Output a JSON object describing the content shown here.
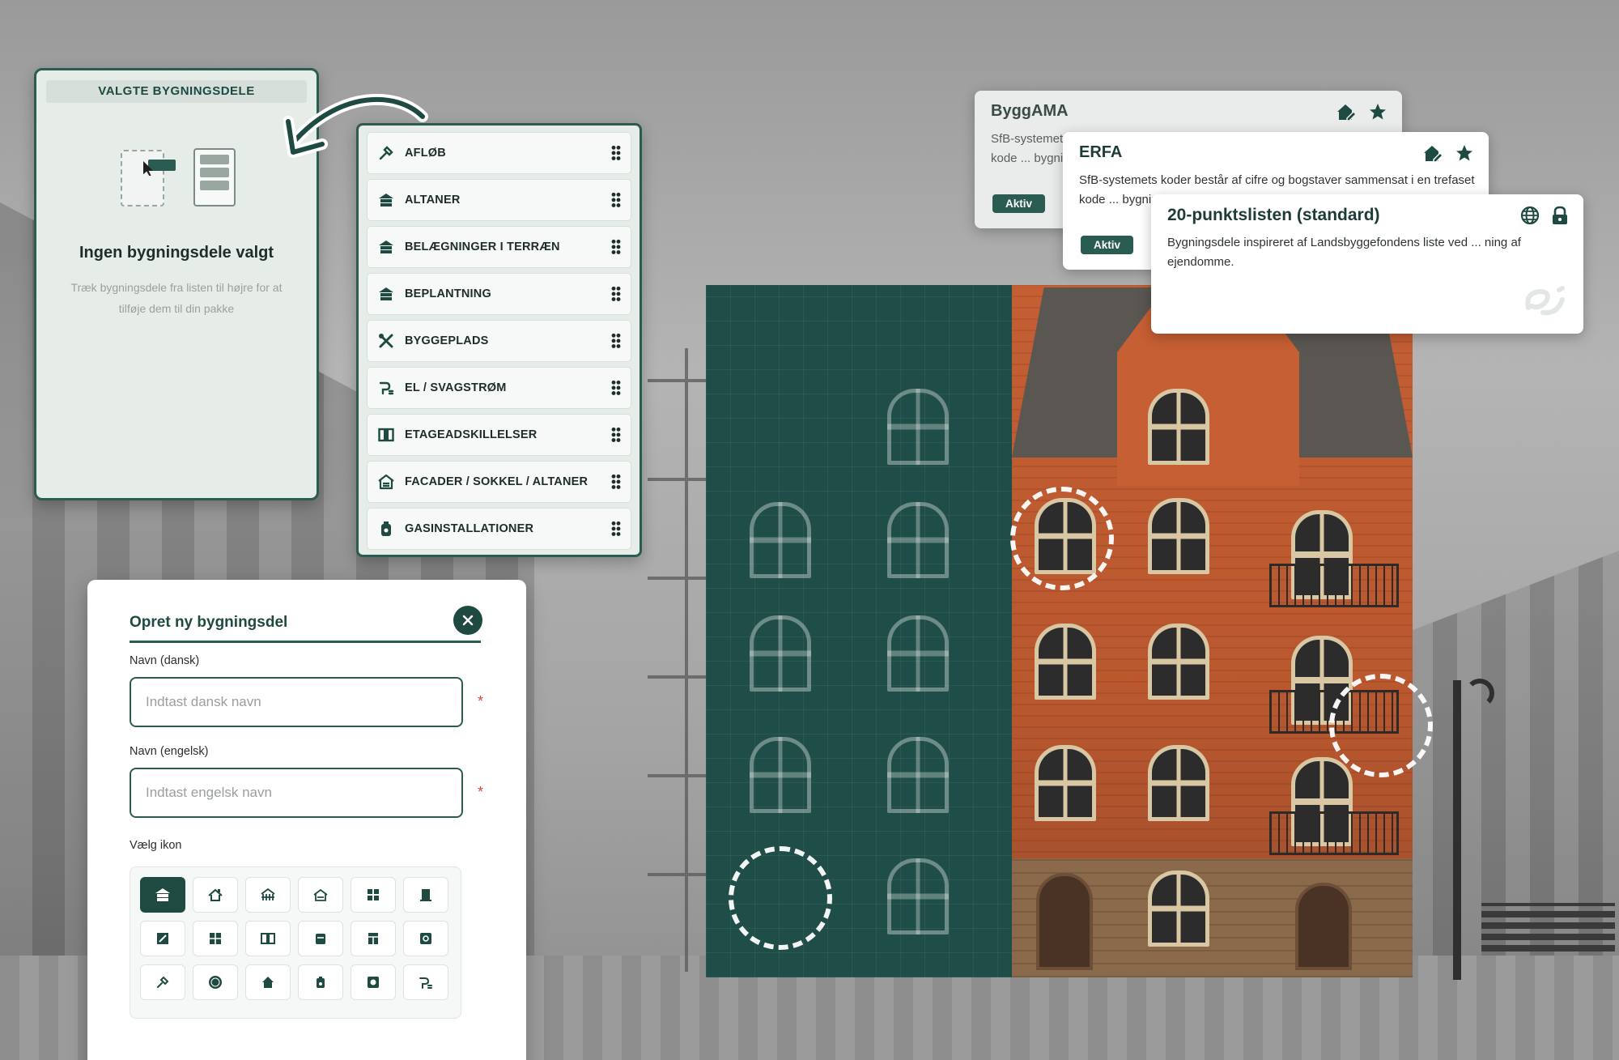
{
  "selected_panel": {
    "header": "VALGTE BYGNINGSDELE",
    "empty_title": "Ingen bygningsdele valgt",
    "empty_text": "Træk bygningsdele fra listen til højre for at tilføje dem til din pakke"
  },
  "building_parts": [
    {
      "label": "AFLØB",
      "icon": "drill-icon"
    },
    {
      "label": "ALTANER",
      "icon": "building-icon"
    },
    {
      "label": "BELÆGNINGER I TERRÆN",
      "icon": "building-icon"
    },
    {
      "label": "BEPLANTNING",
      "icon": "building-icon"
    },
    {
      "label": "BYGGEPLADS",
      "icon": "tools-icon"
    },
    {
      "label": "EL / SVAGSTRØM",
      "icon": "plug-icon"
    },
    {
      "label": "ETAGEADSKILLELSER",
      "icon": "panel-icon"
    },
    {
      "label": "FACADER / SOKKEL / ALTANER",
      "icon": "facade-icon"
    },
    {
      "label": "GASINSTALLATIONER",
      "icon": "gas-icon"
    }
  ],
  "create_form": {
    "title": "Opret ny bygningsdel",
    "name_da_label": "Navn (dansk)",
    "name_da_placeholder": "Indtast dansk navn",
    "name_en_label": "Navn (engelsk)",
    "name_en_placeholder": "Indtast engelsk navn",
    "required_mark": "*",
    "icon_label": "Vælg ikon",
    "icon_options": [
      "building-icon",
      "roof-icon",
      "bridge-icon",
      "facade-icon",
      "grid-icon",
      "door-icon",
      "panel-icon",
      "window-icon",
      "wall-icon",
      "gas-icon",
      "column-icon",
      "gear-icon",
      "drill-icon",
      "circle-icon",
      "house-icon",
      "gas-icon",
      "square-icon",
      "plug-icon"
    ],
    "selected_icon_index": 0
  },
  "standards": [
    {
      "title": "ByggAMA",
      "description": "SfB-systemets koder består af cifre og bogstaver sammensat i en trefaset kode ... bygningsdele",
      "badge": "Aktiv",
      "icons": [
        "house-edit-icon",
        "star-icon"
      ]
    },
    {
      "title": "ERFA",
      "description": "SfB-systemets koder består af cifre og bogstaver sammensat i en trefaset kode ... bygningsdele",
      "badge": "Aktiv",
      "icons": [
        "house-edit-icon",
        "star-icon"
      ]
    },
    {
      "title": "20-punktslisten (standard)",
      "description": "Bygningsdele inspireret af Landsbyggefondens liste ved ... ning af ejendomme.",
      "icons": [
        "globe-icon",
        "lock-icon"
      ]
    }
  ],
  "colors": {
    "brand": "#1e4a41",
    "accent": "#2b5c51",
    "panel_bg": "#e6ece8",
    "required": "#d64545"
  }
}
